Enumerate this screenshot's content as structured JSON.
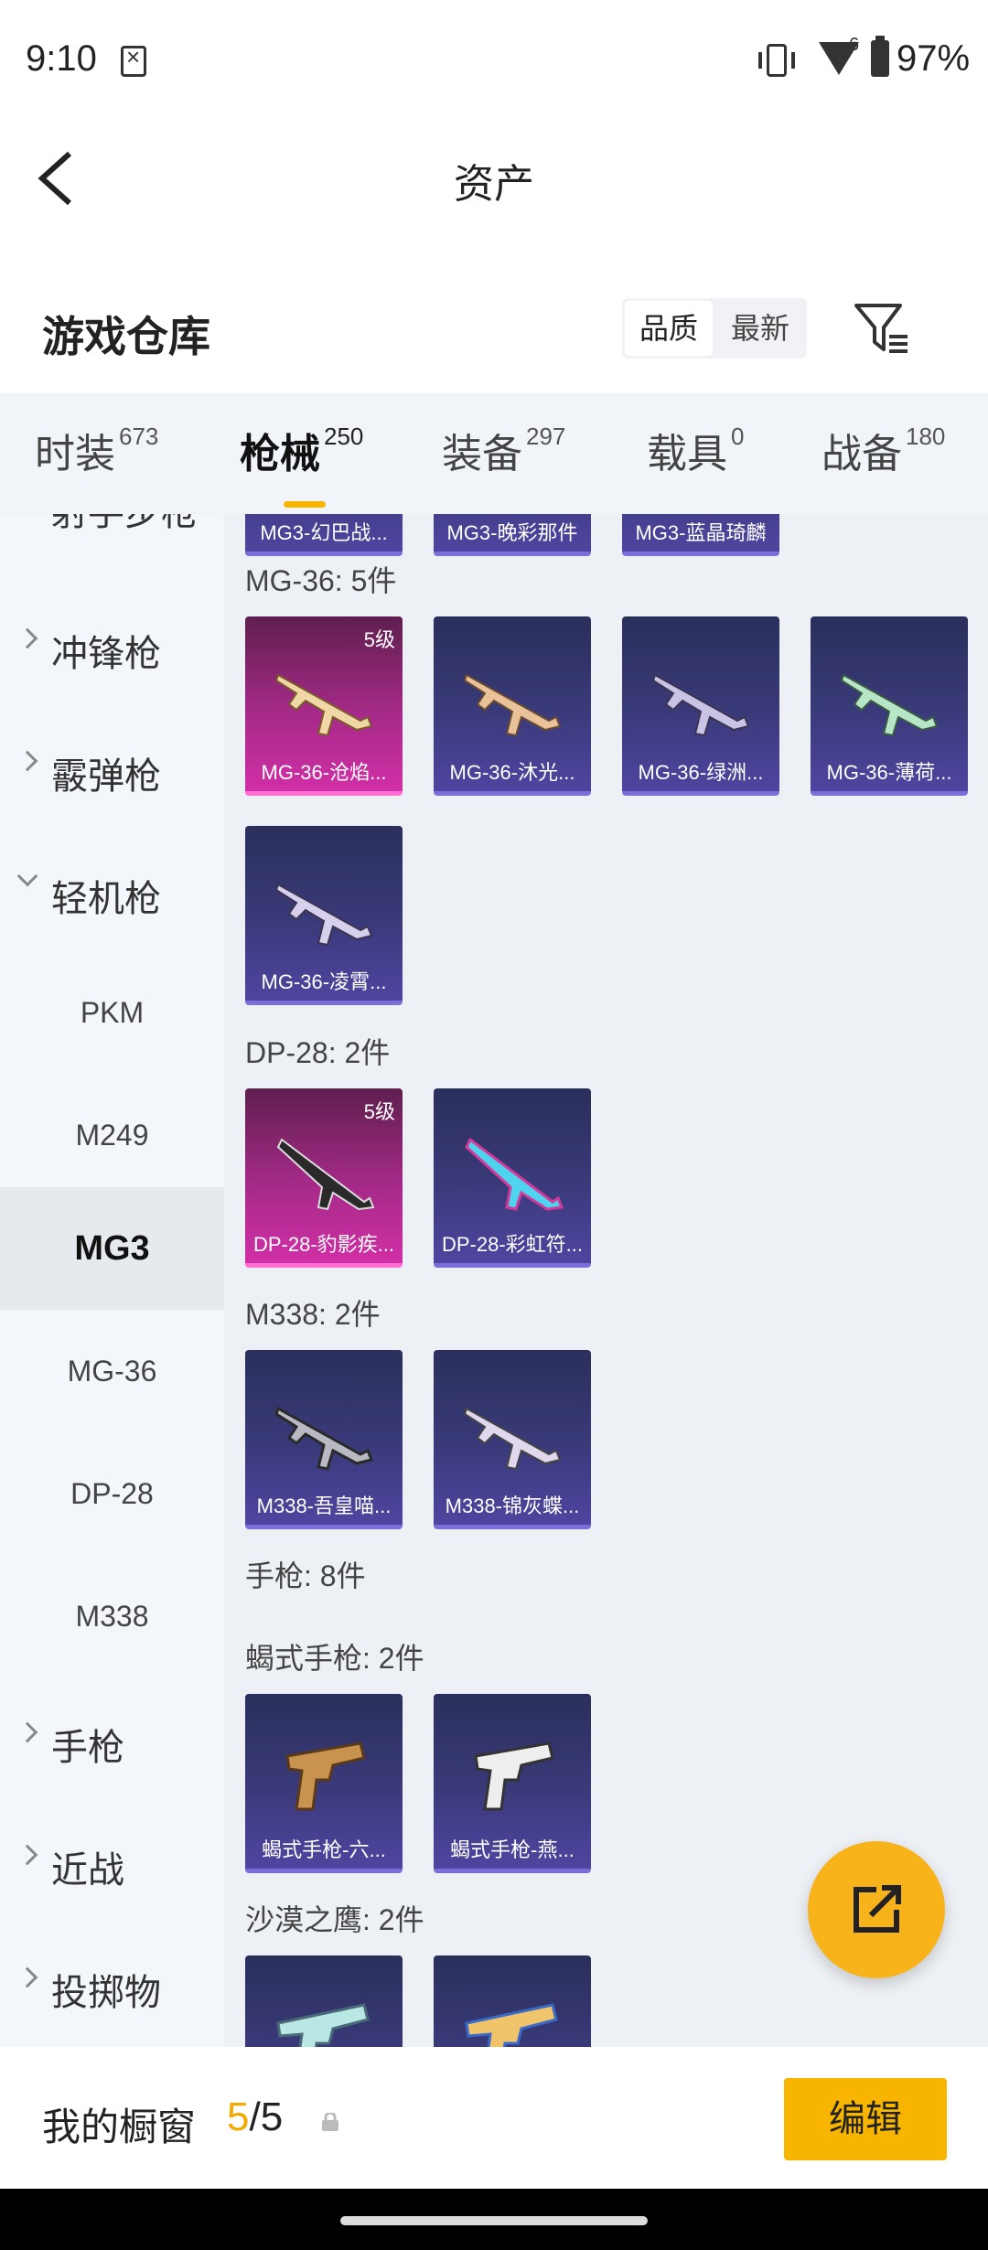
{
  "status_bar": {
    "time": "9:10",
    "signal_label": "6",
    "battery": "97%"
  },
  "header": {
    "title": "资产"
  },
  "warehouse": {
    "title": "游戏仓库",
    "sort_quality": "品质",
    "sort_newest": "最新"
  },
  "tabs": [
    {
      "label": "时装",
      "count": "673"
    },
    {
      "label": "枪械",
      "count": "250"
    },
    {
      "label": "装备",
      "count": "297"
    },
    {
      "label": "载具",
      "count": "0"
    },
    {
      "label": "战备",
      "count": "180"
    }
  ],
  "sidenav": {
    "partial": "射手步枪",
    "smg": "冲锋枪",
    "shotgun": "霰弹枪",
    "lmg": "轻机枪",
    "subs": [
      "PKM",
      "M249",
      "MG3",
      "MG-36",
      "DP-28",
      "M338"
    ],
    "pistol": "手枪",
    "melee": "近战",
    "throwable": "投掷物"
  },
  "content": {
    "sections": [
      "MG-36: 5件",
      "DP-28: 2件",
      "M338: 2件",
      "手枪: 8件",
      "蝎式手枪: 2件",
      "沙漠之鹰: 2件"
    ],
    "top_partial": [
      "MG3-幻巴战...",
      "MG3-晚彩那件",
      "MG3-蓝晶琦麟"
    ],
    "cards": [
      {
        "name": "MG-36-沧焰...",
        "level": "5级"
      },
      {
        "name": "MG-36-沐光..."
      },
      {
        "name": "MG-36-绿洲..."
      },
      {
        "name": "MG-36-薄荷..."
      },
      {
        "name": "MG-36-凌霄..."
      },
      {
        "name": "DP-28-豹影疾...",
        "level": "5级"
      },
      {
        "name": "DP-28-彩虹符..."
      },
      {
        "name": "M338-吾皇喵..."
      },
      {
        "name": "M338-锦灰蝶..."
      },
      {
        "name": "蝎式手枪-六..."
      },
      {
        "name": "蝎式手枪-燕..."
      }
    ]
  },
  "bottom_bar": {
    "label": "我的橱窗",
    "current": "5",
    "separator": "/",
    "total": "5",
    "edit": "编辑"
  },
  "colors": {
    "accent": "#f7b500",
    "legend_card": "#c42a98",
    "epic_card": "#3f3a86"
  }
}
